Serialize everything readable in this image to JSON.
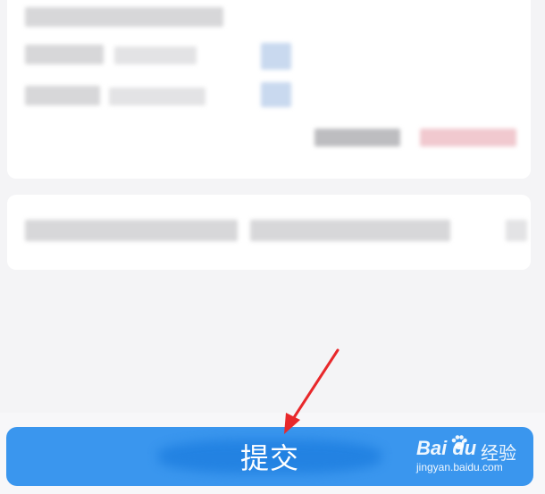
{
  "submit": {
    "label": "提交"
  },
  "watermark": {
    "brand": "Bai du",
    "brand_cn": "经验",
    "url": "jingyan.baidu.com"
  },
  "colors": {
    "background": "#f4f4f6",
    "card": "#ffffff",
    "button": "#3a96ee",
    "arrow": "#e8282b"
  },
  "icons": {
    "annotation_arrow": "red-arrow-icon",
    "watermark_paw": "paw-icon"
  }
}
